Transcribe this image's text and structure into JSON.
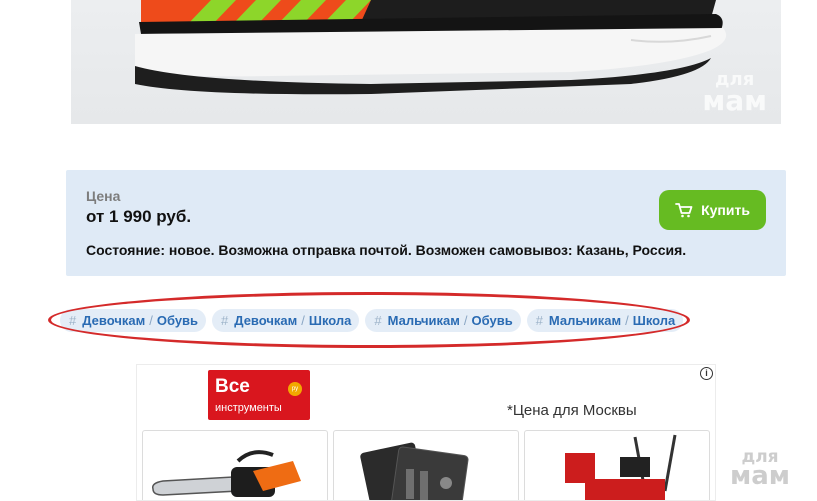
{
  "photo": {
    "watermark_top": "для",
    "watermark_bottom": "мам"
  },
  "price_box": {
    "label": "Цена",
    "value": "от 1 990 руб.",
    "condition": "Состояние: новое. Возможна отправка почтой. Возможен самовывоз: Казань, Россия.",
    "buy_label": "Купить",
    "buy_color": "#66bb22"
  },
  "tags": [
    {
      "hash": "#",
      "part1": "Девочкам",
      "sep": "/",
      "part2": "Обувь"
    },
    {
      "hash": "#",
      "part1": "Девочкам",
      "sep": "/",
      "part2": "Школа"
    },
    {
      "hash": "#",
      "part1": "Мальчикам",
      "sep": "/",
      "part2": "Обувь"
    },
    {
      "hash": "#",
      "part1": "Мальчикам",
      "sep": "/",
      "part2": "Школа"
    }
  ],
  "highlight_color": "#d42a2a",
  "ad": {
    "logo_line1": "Все",
    "logo_line2": "инструменты",
    "logo_dot": "ру",
    "price_note": "*Цена для Москвы",
    "info_icon": "i",
    "products": [
      "chainsaw",
      "tool-case",
      "snow-blower"
    ]
  },
  "corner_watermark": {
    "top": "для",
    "bottom": "мам"
  }
}
